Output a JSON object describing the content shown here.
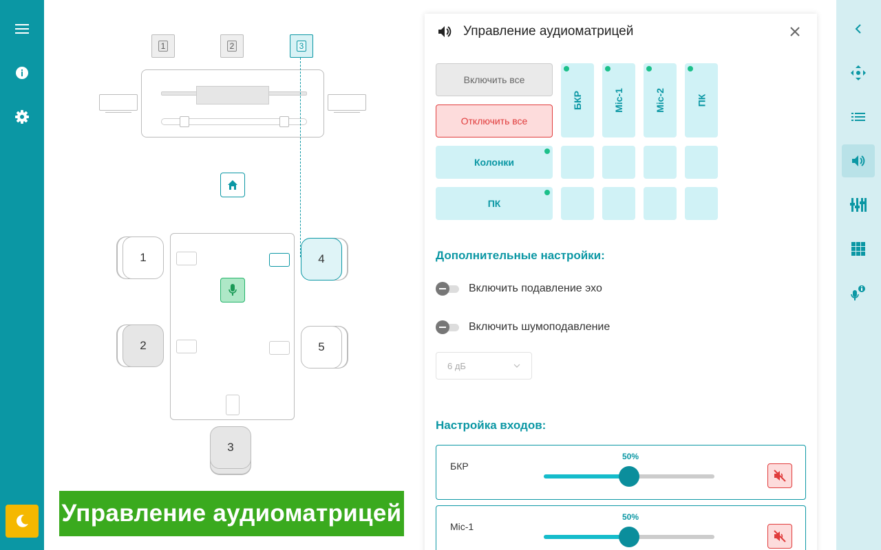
{
  "left_rail": {
    "icons": [
      "menu-icon",
      "info-icon",
      "gear-icon",
      "moon-icon"
    ]
  },
  "right_rail": {
    "icons": [
      "chevron-left-icon",
      "move-icon",
      "list-icon",
      "speaker-icon",
      "equalizer-icon",
      "grid-icon",
      "mic-info-icon"
    ],
    "active_index": 3
  },
  "plan": {
    "cameras": [
      "1",
      "2",
      "3"
    ],
    "active_camera": "3",
    "seats": [
      "1",
      "2",
      "3",
      "4",
      "5"
    ],
    "active_seat": "4"
  },
  "banner": {
    "text": "Управление аудиоматрицей"
  },
  "panel": {
    "title": "Управление аудиоматрицей",
    "enable_all": "Включить все",
    "disable_all": "Отключить все",
    "columns": [
      "БКР",
      "Mic-1",
      "Mic-2",
      "ПК"
    ],
    "rows": [
      "Колонки",
      "ПК"
    ],
    "extra_title": "Дополнительные настройки:",
    "echo_label": "Включить подавление эхо",
    "noise_label": "Включить шумоподавление",
    "noise_level": "6 дБ",
    "inputs_title": "Настройка входов:",
    "inputs": [
      {
        "name": "БКР",
        "level": "50%",
        "value": 50
      },
      {
        "name": "Mic-1",
        "level": "50%",
        "value": 50
      }
    ]
  },
  "colors": {
    "primary": "#0b97a4",
    "light": "#d0f2f6",
    "danger": "#e03c3c",
    "accent_green": "#3aaa1e",
    "theme_button": "#f5b800"
  }
}
